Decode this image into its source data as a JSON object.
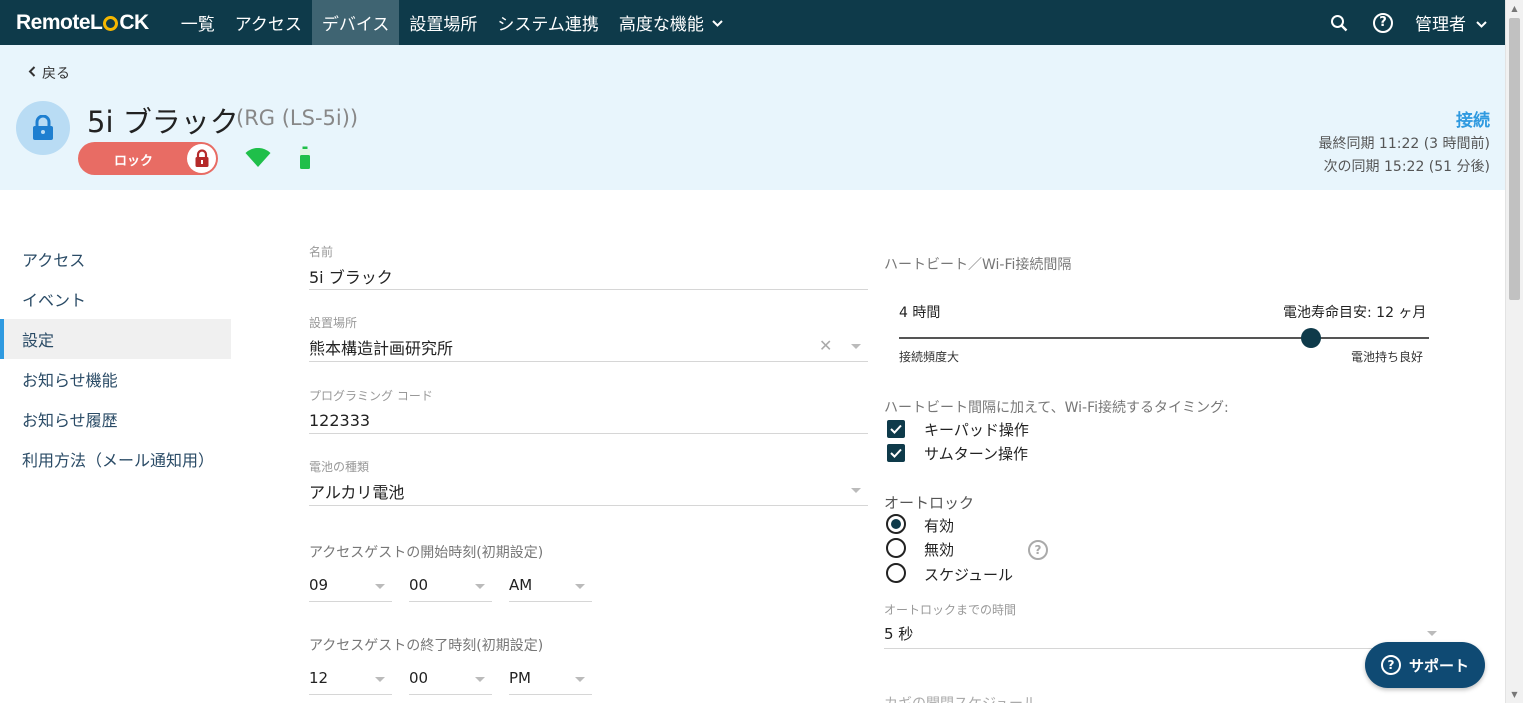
{
  "nav": {
    "logo_left": "Remote",
    "logo_mid": "L",
    "logo_right": "CK",
    "items": [
      "一覧",
      "アクセス",
      "デバイス",
      "設置場所",
      "システム連携",
      "高度な機能"
    ],
    "admin": "管理者"
  },
  "header": {
    "back": "戻る",
    "device_name": "5i ブラック",
    "device_model": "(RG (LS-5i))",
    "lock_label": "ロック",
    "connection": "接続",
    "last_sync": "最終同期  11:22 (3 時間前)",
    "next_sync": "次の同期  15:22 (51 分後)"
  },
  "sidemenu": {
    "items": [
      "アクセス",
      "イベント",
      "設定",
      "お知らせ機能",
      "お知らせ履歴",
      "利用方法（メール通知用）"
    ]
  },
  "form": {
    "name_label": "名前",
    "name_value": "5i ブラック",
    "location_label": "設置場所",
    "location_value": "熊本構造計画研究所",
    "code_label": "プログラミング コード",
    "code_value": "122333",
    "battery_label": "電池の種類",
    "battery_value": "アルカリ電池",
    "start_label": "アクセスゲストの開始時刻(初期設定)",
    "start_hour": "09",
    "start_min": "00",
    "start_ampm": "AM",
    "end_label": "アクセスゲストの終了時刻(初期設定)",
    "end_hour": "12",
    "end_min": "00",
    "end_ampm": "PM"
  },
  "heartbeat": {
    "label": "ハートビート／Wi-Fi接続間隔",
    "interval": "4 時間",
    "battery_life": "電池寿命目安: 12 ヶ月",
    "min_label": "接続頻度大",
    "max_label": "電池持ち良好",
    "timing_label": "ハートビート間隔に加えて、Wi-Fi接続するタイミング:",
    "keypad": "キーパッド操作",
    "thumbturn": "サムターン操作"
  },
  "autolock": {
    "label": "オートロック",
    "enabled": "有効",
    "disabled": "無効",
    "schedule": "スケジュール",
    "time_label": "オートロックまでの時間",
    "time_value": "5 秒",
    "cut_label": "カギの開閉スケジュール"
  },
  "support": "サポート",
  "colors": {
    "nav_bg": "#0e3a4a",
    "header_bg": "#e8f5fc",
    "accent": "#2f9ae0",
    "lock_red": "#e86c64",
    "wifi_green": "#1fbf4a"
  }
}
